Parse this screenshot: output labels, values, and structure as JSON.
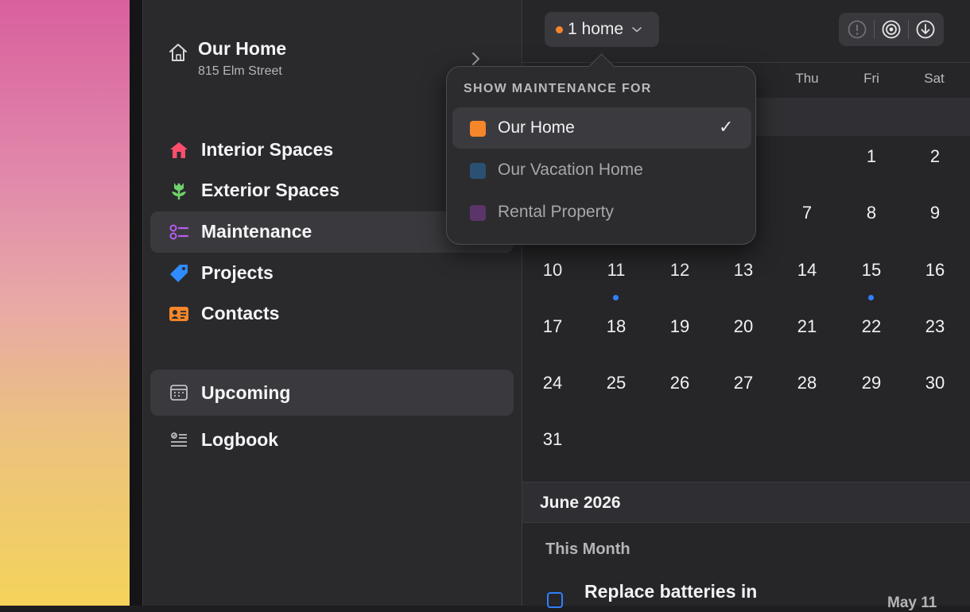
{
  "sidebar": {
    "home": {
      "title": "Our Home",
      "address": "815 Elm Street"
    },
    "nav": [
      {
        "label": "Interior Spaces",
        "icon": "house-fill-icon",
        "color": "#ff4d6d"
      },
      {
        "label": "Exterior Spaces",
        "icon": "tulip-icon",
        "color": "#6fd36b"
      },
      {
        "label": "Maintenance",
        "icon": "checklist-icon",
        "color": "#b65cf0",
        "active": true
      },
      {
        "label": "Projects",
        "icon": "tag-icon",
        "color": "#2f8cff"
      },
      {
        "label": "Contacts",
        "icon": "contact-card-icon",
        "color": "#f5862a"
      }
    ],
    "secondary": [
      {
        "label": "Upcoming",
        "icon": "calendar-icon",
        "active": true
      },
      {
        "label": "Logbook",
        "icon": "logbook-icon"
      }
    ]
  },
  "toolbar": {
    "home_filter": "1 home",
    "icons": [
      "info-icon",
      "target-icon",
      "download-icon"
    ]
  },
  "calendar": {
    "weekdays": [
      "Thu",
      "Fri",
      "Sat"
    ],
    "weeks": [
      [
        "",
        "",
        "",
        "",
        "",
        "1",
        "2"
      ],
      [
        "",
        "",
        "",
        "",
        "7",
        "8",
        "9"
      ],
      [
        "10",
        "11",
        "12",
        "13",
        "14",
        "15",
        "16"
      ],
      [
        "17",
        "18",
        "19",
        "20",
        "21",
        "22",
        "23"
      ],
      [
        "24",
        "25",
        "26",
        "27",
        "28",
        "29",
        "30"
      ],
      [
        "31",
        "",
        "",
        "",
        "",
        "",
        ""
      ]
    ],
    "event_days": [
      "11",
      "15"
    ]
  },
  "upcoming": {
    "section": "June 2026",
    "group": "This Month",
    "task": {
      "title": "Replace batteries in",
      "date": "May 11"
    }
  },
  "popover": {
    "title": "SHOW MAINTENANCE FOR",
    "items": [
      {
        "label": "Our Home",
        "color": "#f5862a",
        "selected": true
      },
      {
        "label": "Our Vacation Home",
        "color": "#2a5173",
        "selected": false
      },
      {
        "label": "Rental Property",
        "color": "#5b3569",
        "selected": false
      }
    ],
    "checkmark": "✓"
  }
}
